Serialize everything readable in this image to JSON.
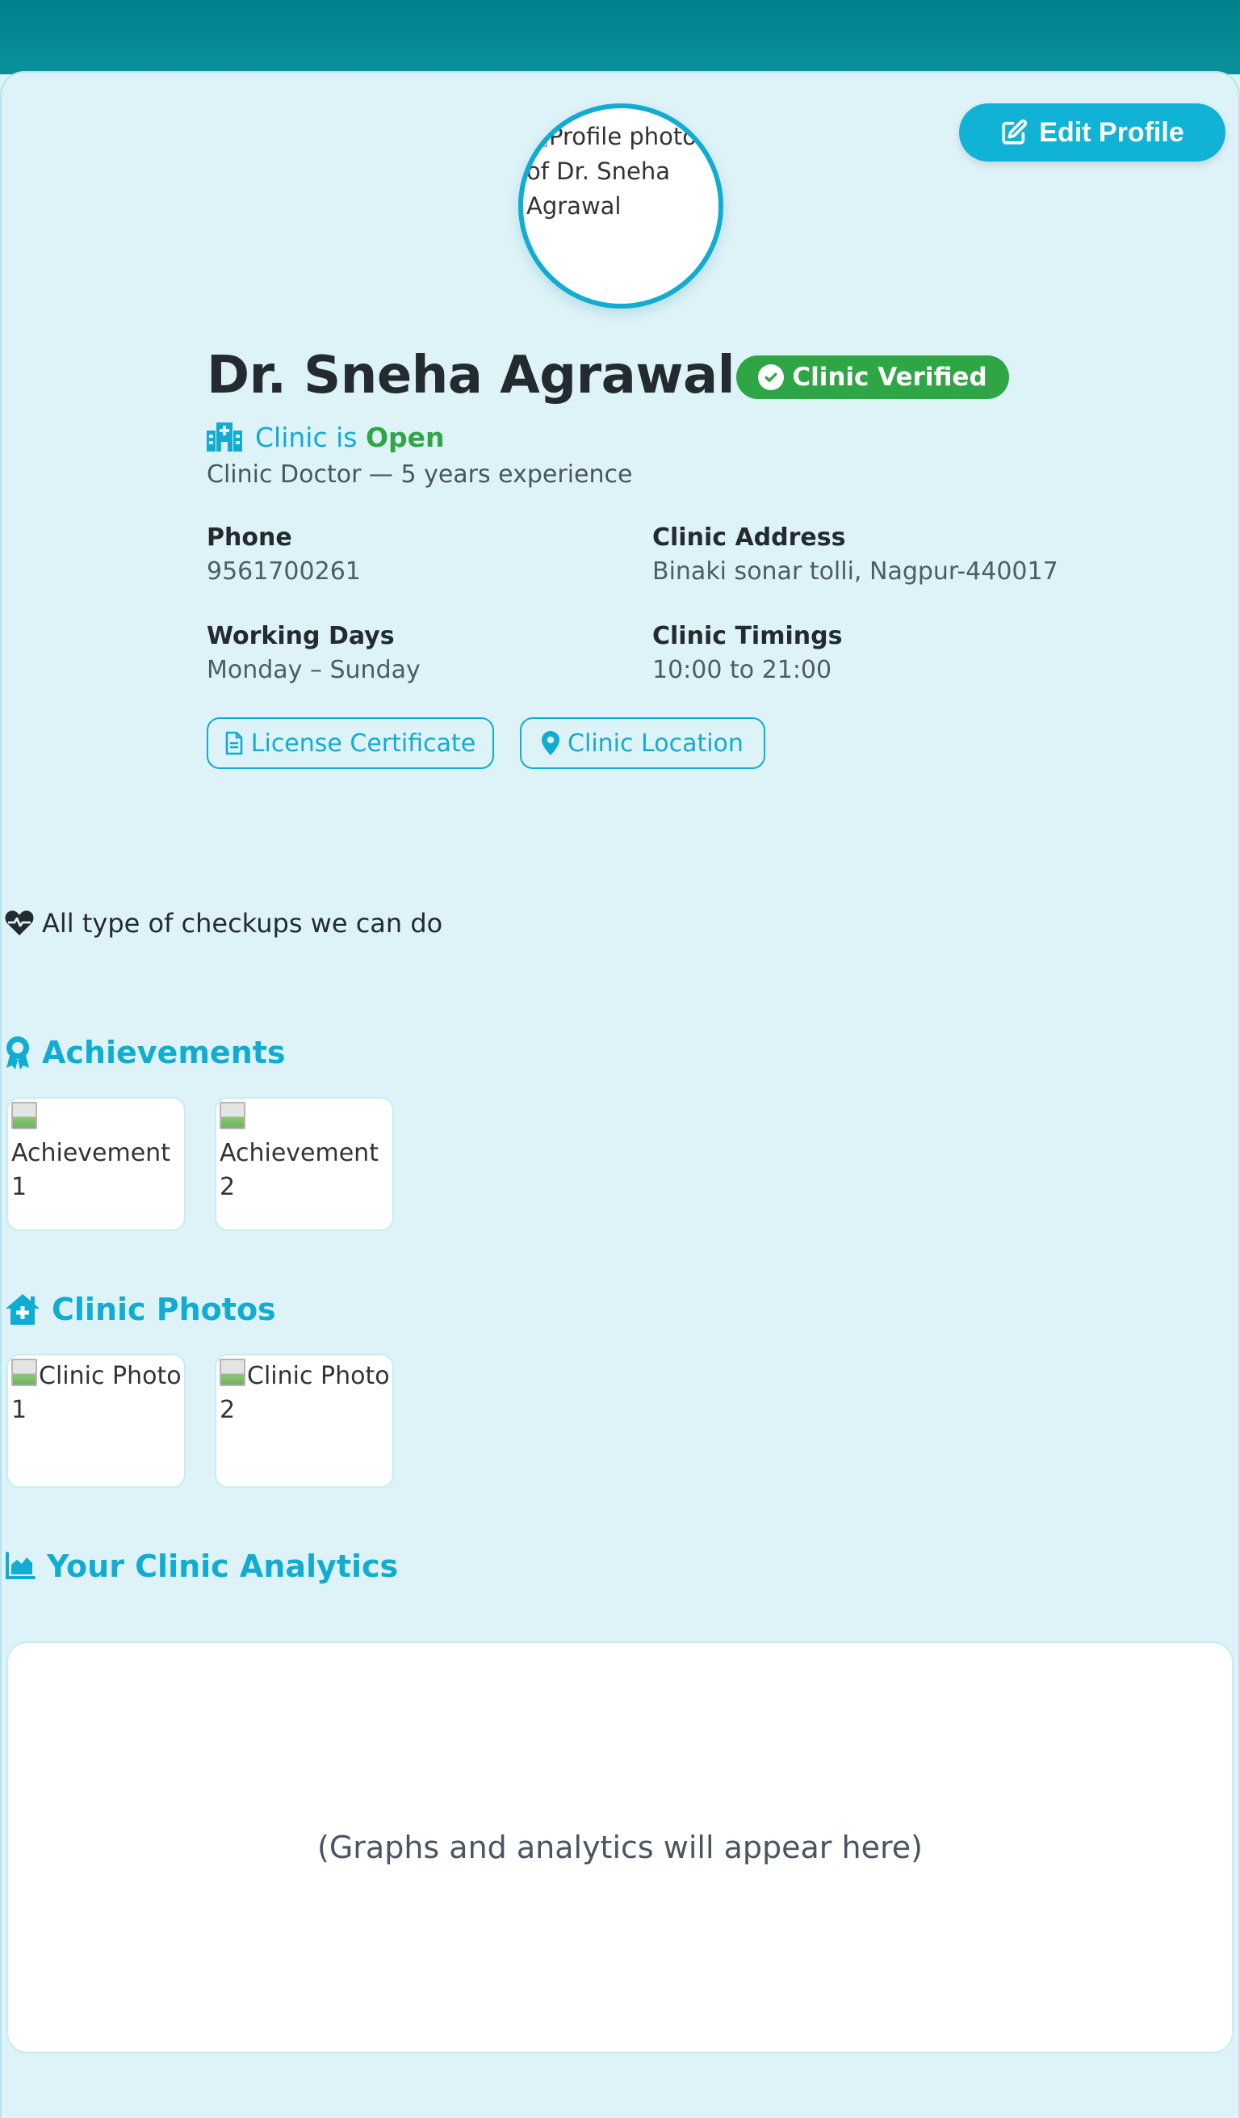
{
  "header": {
    "edit_profile_label": "Edit Profile"
  },
  "profile": {
    "photo_alt": "Profile photo of Dr. Sneha Agrawal",
    "name": "Dr. Sneha Agrawal",
    "verified_badge": "Clinic Verified",
    "clinic_status_prefix": "Clinic is",
    "clinic_status": "Open",
    "specialty": "Clinic Doctor — 5 years experience"
  },
  "info": {
    "phone_label": "Phone",
    "phone_value": "9561700261",
    "address_label": "Clinic Address",
    "address_value": "Binaki sonar tolli, Nagpur-440017",
    "days_label": "Working Days",
    "days_value": "Monday – Sunday",
    "timings_label": "Clinic Timings",
    "timings_value": "10:00 to 21:00"
  },
  "actions": {
    "license_label": "License Certificate",
    "location_label": "Clinic Location"
  },
  "about": {
    "text": "All type of checkups we can do"
  },
  "achievements": {
    "title": "Achievements",
    "items": [
      {
        "alt": "Achievement 1"
      },
      {
        "alt": "Achievement 2"
      }
    ]
  },
  "clinic_photos": {
    "title": "Clinic Photos",
    "items": [
      {
        "alt": "Clinic Photo 1"
      },
      {
        "alt": "Clinic Photo 2"
      }
    ]
  },
  "analytics": {
    "title": "Your Clinic Analytics",
    "placeholder": "(Graphs and analytics will appear here)"
  },
  "colors": {
    "header_teal": "#00808e",
    "accent": "#10acd1",
    "success": "#2ea645",
    "card_bg": "#def3f8"
  },
  "icons": {
    "edit": "edit-icon",
    "verified": "check-circle-icon",
    "clinic": "hospital-icon",
    "license": "file-icon",
    "location": "map-pin-icon",
    "about": "heart-pulse-icon",
    "achievements": "award-icon",
    "clinic_photos": "clinic-house-icon",
    "analytics": "area-chart-icon"
  }
}
